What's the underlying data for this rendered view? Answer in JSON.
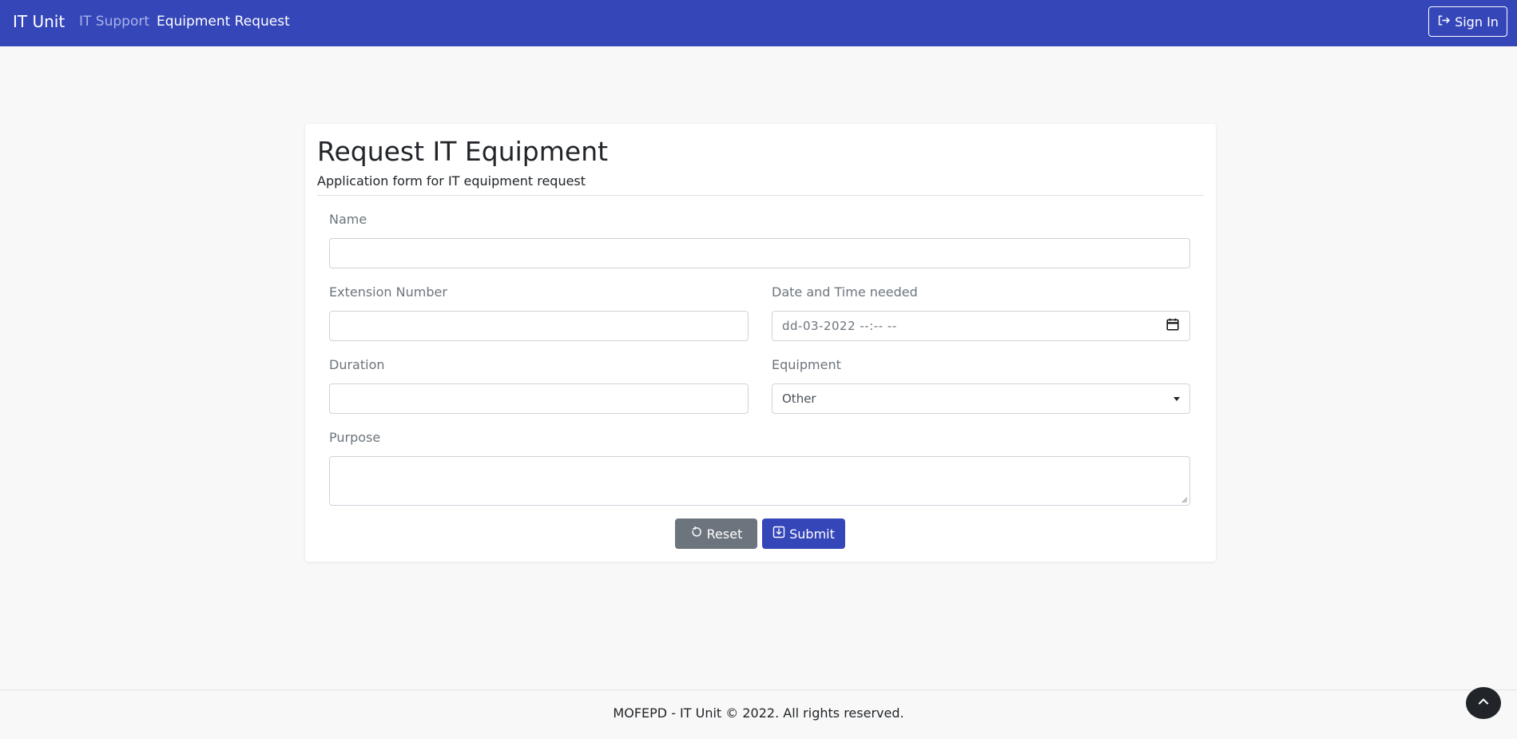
{
  "navbar": {
    "brand": "IT Unit",
    "links": [
      {
        "label": "IT Support"
      },
      {
        "label": "Equipment Request"
      }
    ],
    "signin_label": "Sign In"
  },
  "form": {
    "title": "Request IT Equipment",
    "subtitle": "Application form for IT equipment request",
    "fields": {
      "name": {
        "label": "Name",
        "value": ""
      },
      "extension": {
        "label": "Extension Number",
        "value": ""
      },
      "datetime": {
        "label": "Date and Time needed",
        "value": "dd-03-2022 --:-- --"
      },
      "duration": {
        "label": "Duration",
        "value": ""
      },
      "equipment": {
        "label": "Equipment",
        "selected": "Other"
      },
      "purpose": {
        "label": "Purpose",
        "value": ""
      }
    },
    "buttons": {
      "reset_label": "Reset",
      "submit_label": "Submit"
    }
  },
  "footer": {
    "text": "MOFEPD - IT Unit © 2022. All rights reserved."
  },
  "colors": {
    "primary": "#3546b9",
    "secondary": "#6c757d",
    "background": "#f8f8f8",
    "dark": "#212529"
  },
  "icons": {
    "signin": "sign-in-icon",
    "calendar": "calendar-icon",
    "dropdown": "chevron-down-icon",
    "reset": "reset-icon",
    "submit": "download-icon",
    "back_to_top": "chevron-up-icon"
  }
}
